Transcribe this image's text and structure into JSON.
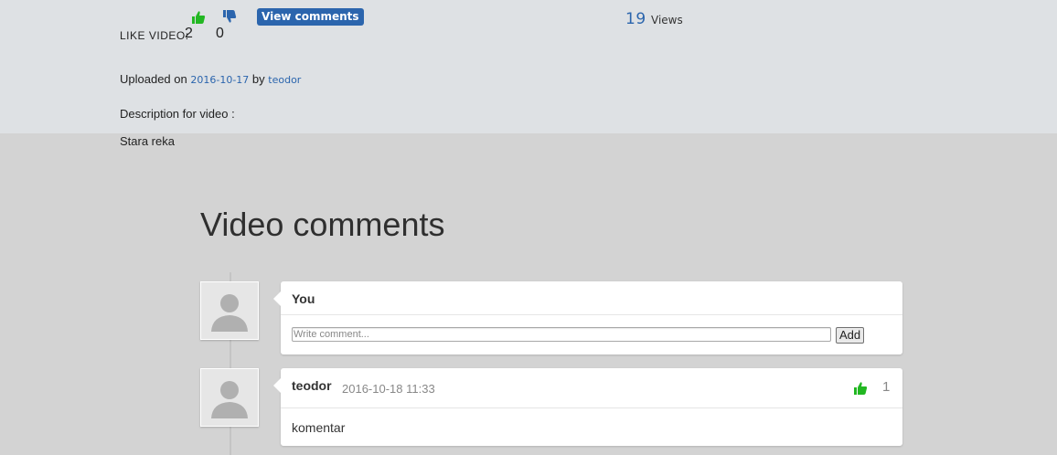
{
  "video": {
    "like_label": "LIKE VIDEO:",
    "like_count": "2",
    "dislike_count": "0",
    "view_comments_label": "View comments",
    "views_count": "19",
    "views_label": "Views",
    "uploaded_prefix": "Uploaded on",
    "upload_date": "2016-10-17",
    "uploaded_by_word": "by",
    "uploader": "teodor",
    "description_label": "Description for video :",
    "description": "Stara reka"
  },
  "comments_section": {
    "title": "Video comments",
    "new_comment": {
      "author": "You",
      "input_value": "",
      "placeholder": "Write comment...",
      "submit_label": "Add"
    },
    "comments": [
      {
        "author": "teodor",
        "date": "2016-10-18 11:33",
        "likes": "1",
        "text": "komentar"
      }
    ]
  },
  "colors": {
    "accent": "#2b65ad",
    "like_green": "#22b722",
    "top_panel_bg": "#dee1e4",
    "page_bg": "#d3d3d3"
  },
  "icons": {
    "like": "thumbs-up-icon",
    "dislike": "thumbs-down-icon",
    "avatar": "user-silhouette-icon"
  }
}
